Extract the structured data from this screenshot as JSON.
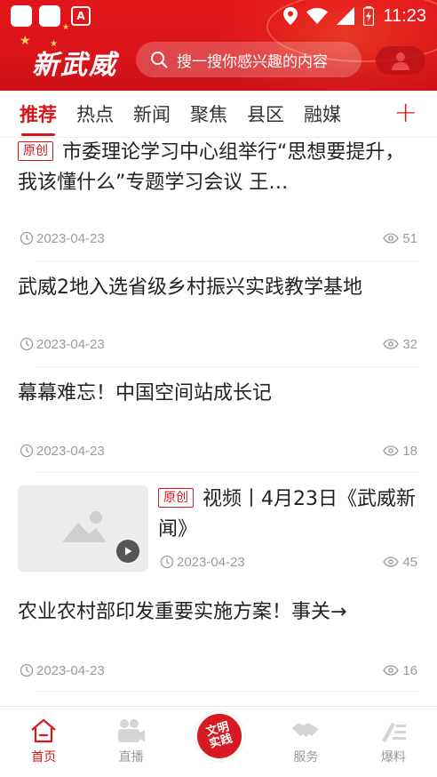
{
  "status_bar": {
    "time": "11:23",
    "app_badge": "A"
  },
  "header": {
    "logo": "新武威",
    "search_placeholder": "搜一搜你感兴趣的内容"
  },
  "tabs": [
    {
      "label": "推荐",
      "active": true
    },
    {
      "label": "热点",
      "active": false
    },
    {
      "label": "新闻",
      "active": false
    },
    {
      "label": "聚焦",
      "active": false
    },
    {
      "label": "县区",
      "active": false
    },
    {
      "label": "融媒",
      "active": false
    }
  ],
  "tab_add": "+",
  "articles": [
    {
      "badge": "原创",
      "title": "市委理论学习中心组举行“思想要提升，我该懂什么”专题学习会议 王…",
      "date": "2023-04-23",
      "views": "51"
    },
    {
      "badge": "",
      "title": "武威2地入选省级乡村振兴实践教学基地",
      "date": "2023-04-23",
      "views": "32"
    },
    {
      "badge": "",
      "title": "幕幕难忘！中国空间站成长记",
      "date": "2023-04-23",
      "views": "18"
    },
    {
      "badge": "原创",
      "title": "视频丨4月23日《武威新闻》",
      "date": "2023-04-23",
      "views": "45"
    },
    {
      "badge": "",
      "title": "农业农村部印发重要实施方案！事关→",
      "date": "2023-04-23",
      "views": "16"
    }
  ],
  "bottom_nav": [
    {
      "label": "首页",
      "icon": "home-icon",
      "active": true
    },
    {
      "label": "直播",
      "icon": "video-camera-icon",
      "active": false
    },
    {
      "label": "",
      "icon": "center",
      "active": false
    },
    {
      "label": "服务",
      "icon": "handshake-icon",
      "active": false
    },
    {
      "label": "爆料",
      "icon": "edit-icon",
      "active": false
    }
  ],
  "center_button": {
    "line1": "文明",
    "line2": "实践"
  },
  "colors": {
    "brand_red": "#d8161c",
    "meta_gray": "#9a9a9a"
  }
}
